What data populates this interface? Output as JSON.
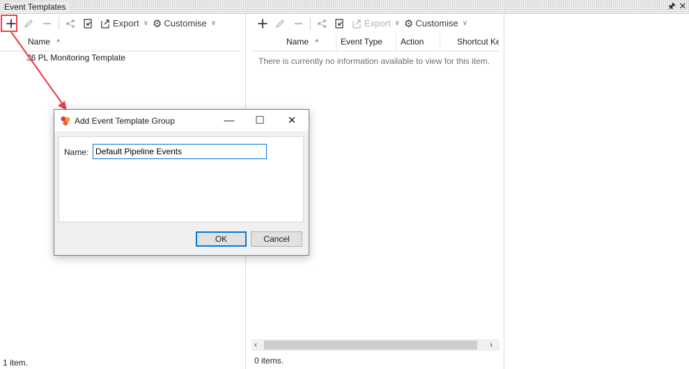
{
  "window": {
    "title": "Event Templates",
    "pin_icon": "pin-icon",
    "close_icon": "close-icon"
  },
  "left_panel": {
    "toolbar": {
      "export_label": "Export",
      "customise_label": "Customise"
    },
    "columns": [
      "Name"
    ],
    "rows": [
      "36 PL Monitoring Template"
    ],
    "status": "1 item."
  },
  "right_panel": {
    "toolbar": {
      "export_label": "Export",
      "customise_label": "Customise"
    },
    "columns": [
      "Name",
      "Event Type",
      "Action",
      "Shortcut Ke"
    ],
    "empty_message": "There is currently no information available to view for this item.",
    "status": "0 items."
  },
  "dialog": {
    "title": "Add Event Template Group",
    "name_label": "Name:",
    "name_value": "Default Pipeline Events",
    "ok_label": "OK",
    "cancel_label": "Cancel"
  },
  "colors": {
    "annotation": "#e8434a",
    "accent": "#0078d7"
  }
}
